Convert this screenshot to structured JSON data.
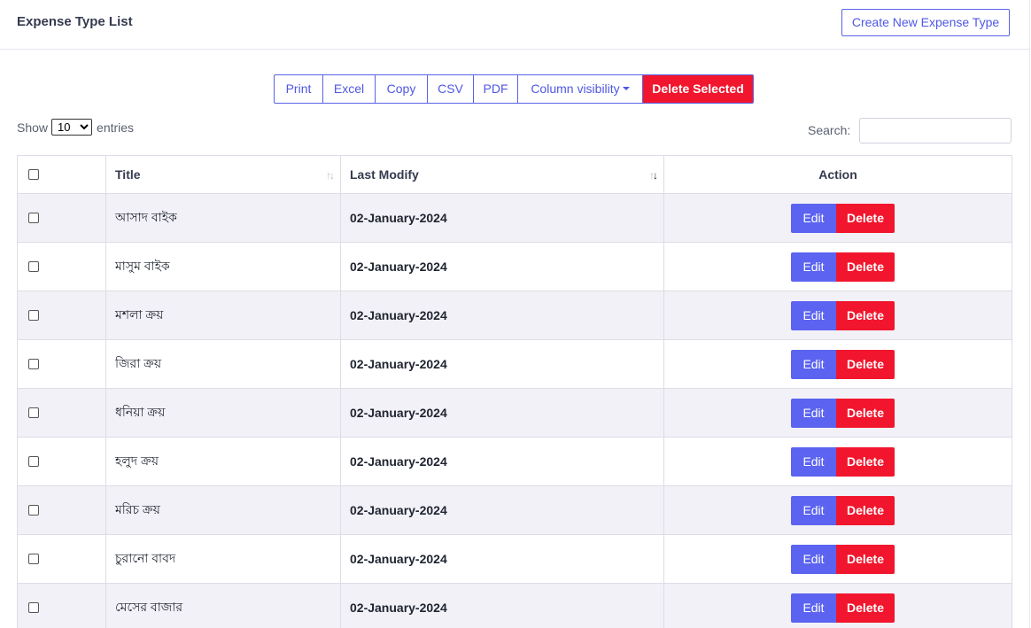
{
  "header": {
    "title": "Expense Type List",
    "create_button": "Create New Expense Type"
  },
  "toolbar": {
    "print": "Print",
    "excel": "Excel",
    "copy": "Copy",
    "csv": "CSV",
    "pdf": "PDF",
    "column_visibility": "Column visibility",
    "delete_selected": "Delete Selected"
  },
  "length_control": {
    "prefix": "Show",
    "selected": "10",
    "suffix": "entries"
  },
  "search": {
    "label": "Search:",
    "value": ""
  },
  "table": {
    "columns": [
      "",
      "Title",
      "Last Modify",
      "Action"
    ],
    "sorted_column": "Last Modify",
    "rows": [
      {
        "title": "আসাদ বাইক",
        "last_modify": "02-January-2024"
      },
      {
        "title": "মাসুম বাইক",
        "last_modify": "02-January-2024"
      },
      {
        "title": "মশলা ক্রয়",
        "last_modify": "02-January-2024"
      },
      {
        "title": "জিরা ক্রয়",
        "last_modify": "02-January-2024"
      },
      {
        "title": "ধনিয়া ক্রয়",
        "last_modify": "02-January-2024"
      },
      {
        "title": "হলুদ ক্রয়",
        "last_modify": "02-January-2024"
      },
      {
        "title": "মরিচ ক্রয়",
        "last_modify": "02-January-2024"
      },
      {
        "title": "চুরানো বাবদ",
        "last_modify": "02-January-2024"
      },
      {
        "title": "মেসের বাজার",
        "last_modify": "02-January-2024"
      }
    ],
    "edit_label": "Edit",
    "delete_label": "Delete"
  },
  "colors": {
    "primary": "#5b63f0",
    "danger": "#f1162d",
    "stripe": "#f2f1f7"
  }
}
